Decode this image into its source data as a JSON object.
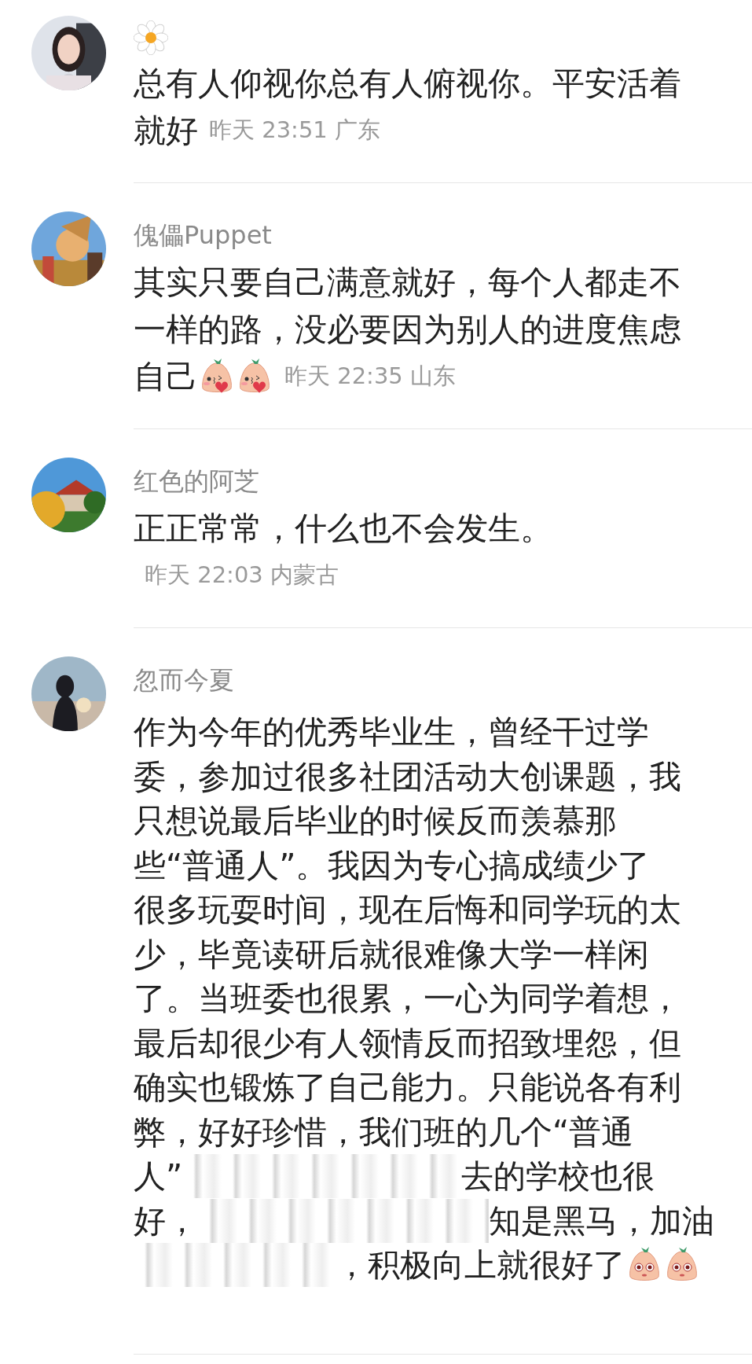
{
  "comments": [
    {
      "name_icon": {
        "kind": "daisy"
      },
      "lines": [
        [
          {
            "kind": "text",
            "text": "总有人仰视你总有人俯视你。平安活着"
          }
        ],
        [
          {
            "kind": "text",
            "text": "就好"
          },
          {
            "kind": "meta",
            "text": "昨天 23:51 广东"
          }
        ]
      ]
    },
    {
      "name": "傀儡Puppet",
      "lines": [
        [
          {
            "kind": "text",
            "text": "其实只要自己满意就好，每个人都走不"
          }
        ],
        [
          {
            "kind": "text",
            "text": "一样的路，没必要因为别人的进度焦虑"
          }
        ],
        [
          {
            "kind": "text",
            "text": "自己"
          },
          {
            "kind": "kiss"
          },
          {
            "kind": "kiss"
          },
          {
            "kind": "meta",
            "text": "昨天 22:35 山东"
          }
        ]
      ]
    },
    {
      "name": "红色的阿芝",
      "lines": [
        [
          {
            "kind": "text",
            "text": "正正常常，什么也不会发生。"
          }
        ],
        [
          {
            "kind": "meta",
            "text": "昨天 22:03 内蒙古"
          }
        ]
      ]
    },
    {
      "name": "忽而今夏",
      "lines": [
        [
          {
            "kind": "text",
            "text": "作为今年的优秀毕业生，曾经干过学"
          }
        ],
        [
          {
            "kind": "text",
            "text": "委，参加过很多社团活动大创课题，我"
          }
        ],
        [
          {
            "kind": "text",
            "text": "只想说最后毕业的时候反而羡慕那"
          }
        ],
        [
          {
            "kind": "text",
            "text": "些“普通人”。我因为专心搞成绩少了"
          }
        ],
        [
          {
            "kind": "text",
            "text": "很多玩耍时间，现在后悔和同学玩的太"
          }
        ],
        [
          {
            "kind": "text",
            "text": "少，毕竟读研后就很难像大学一样闲"
          }
        ],
        [
          {
            "kind": "text",
            "text": "了。当班委也很累，一心为同学着想，"
          }
        ],
        [
          {
            "kind": "text",
            "text": "最后却很少有人领情反而招致埋怨，但"
          }
        ],
        [
          {
            "kind": "text",
            "text": "确实也锻炼了自己能力。只能说各有利"
          }
        ],
        [
          {
            "kind": "text",
            "text": "弊，好好珍惜，我们班的几个“普通"
          }
        ],
        [
          {
            "kind": "text",
            "text": "人”"
          },
          {
            "kind": "redacted"
          },
          {
            "kind": "text",
            "text": "去的学校也很"
          }
        ],
        [
          {
            "kind": "text",
            "text": "好，"
          },
          {
            "kind": "redacted"
          },
          {
            "kind": "text",
            "text": "知是黑马，加油"
          }
        ],
        [
          {
            "kind": "redacted"
          },
          {
            "kind": "text",
            "text": "，积极向上就很好了"
          },
          {
            "kind": "stare"
          },
          {
            "kind": "stare"
          }
        ]
      ]
    }
  ]
}
